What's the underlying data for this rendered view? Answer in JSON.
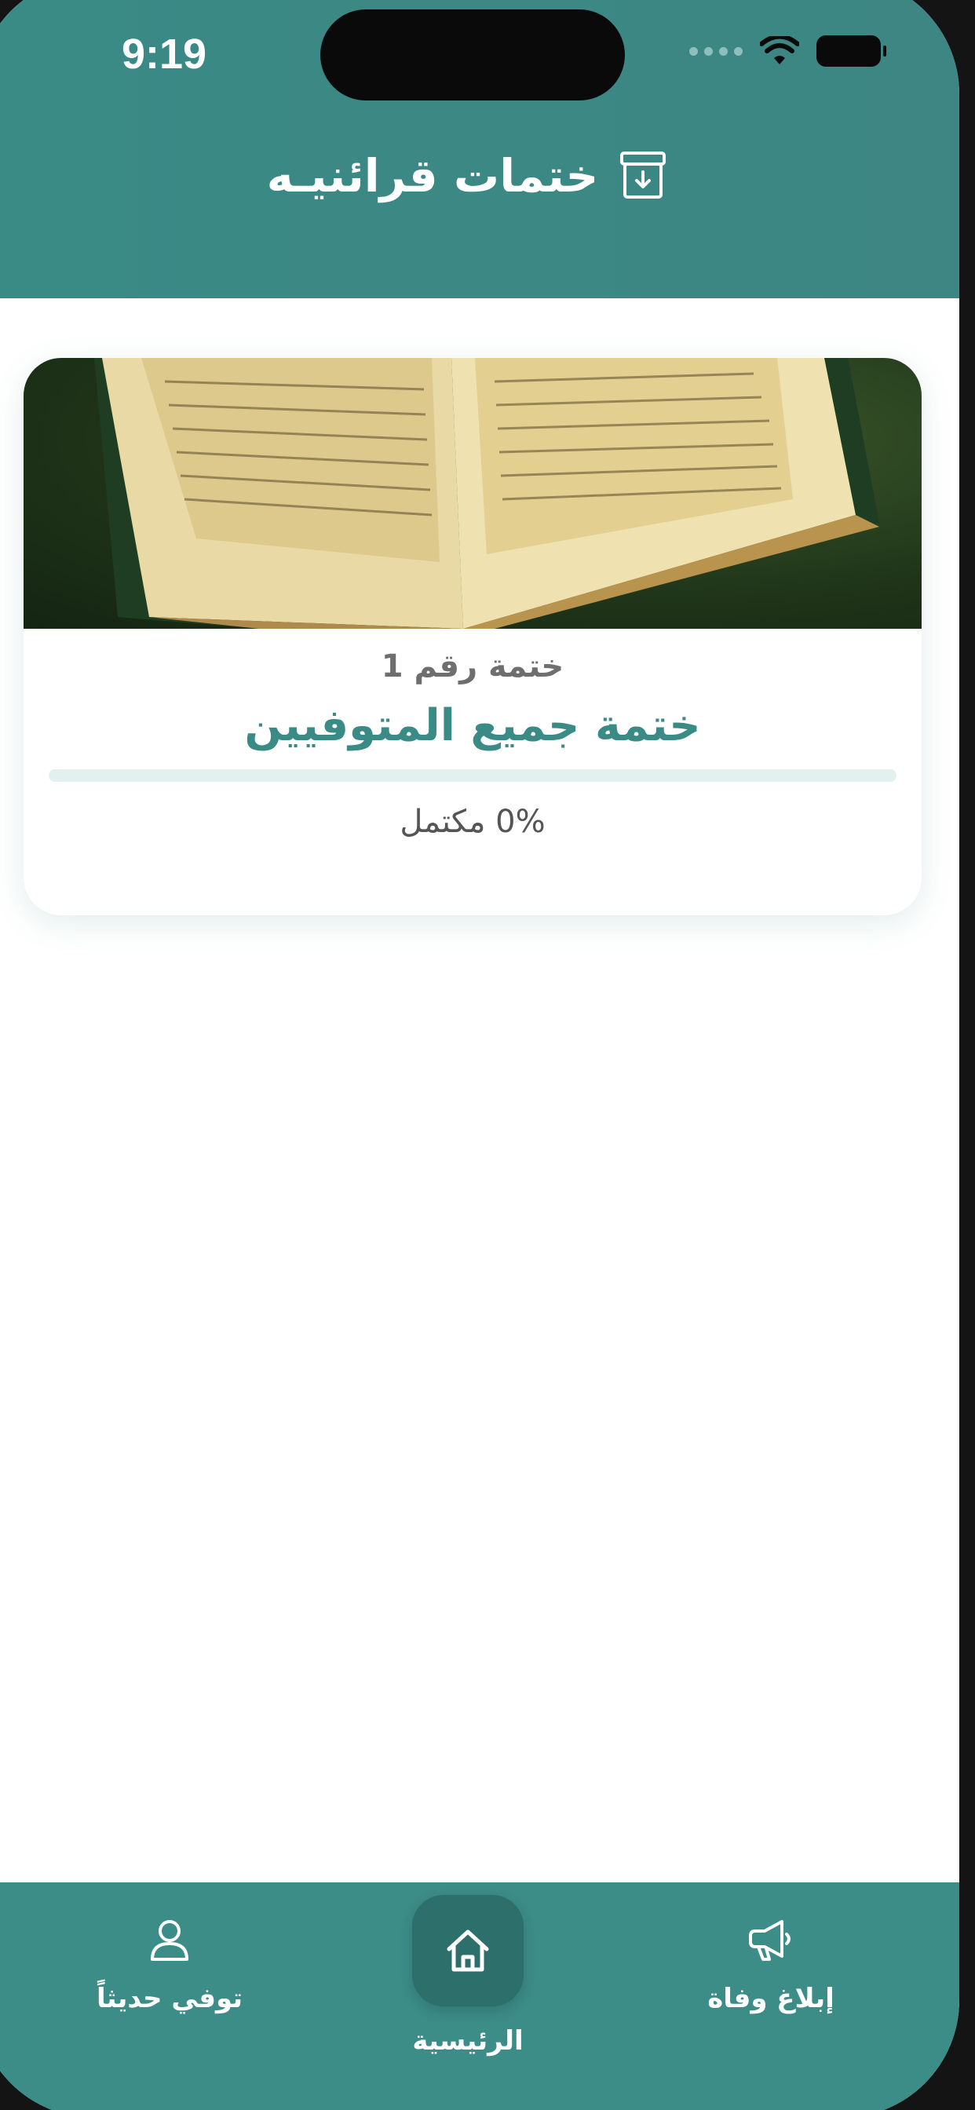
{
  "status_bar": {
    "time": "9:19"
  },
  "header": {
    "title": "ختمات قرائنيـه",
    "icon": "archive-icon"
  },
  "card": {
    "image": "quran-book-image",
    "subtitle": "ختمة رقم 1",
    "title": "ختمة جميع المتوفيين",
    "progress_percent": 0,
    "progress_text": "0% مكتمل"
  },
  "bottom_nav": {
    "items": [
      {
        "label": "توفي حديثاً",
        "icon": "person-icon"
      },
      {
        "label": "الرئيسية",
        "icon": "home-icon",
        "active": true
      },
      {
        "label": "إبلاغ وفاة",
        "icon": "megaphone-icon"
      }
    ]
  },
  "colors": {
    "primary": "#3a8a86",
    "primary_dark": "#2d6f6b",
    "track": "#e2f1ef"
  }
}
